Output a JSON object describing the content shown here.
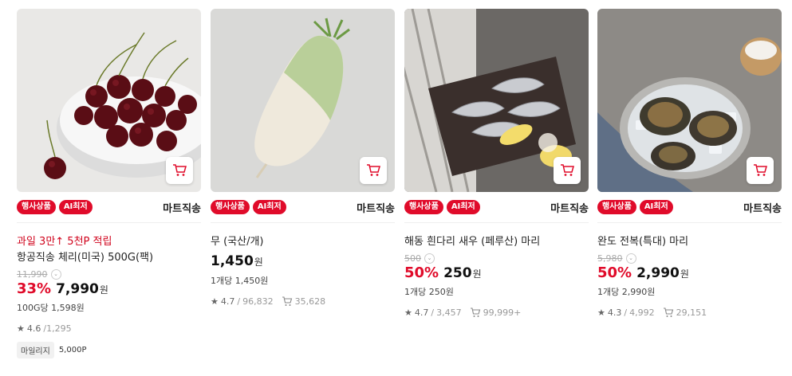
{
  "colors": {
    "accent": "#e00b2a",
    "promo": "#d0021b"
  },
  "products": [
    {
      "badges": [
        "행사상품",
        "AI최저"
      ],
      "seller": "마트직송",
      "promo": "과일 3만↑ 5천P 적립",
      "name": "항공직송 체리(미국) 500G(팩)",
      "original_price": "11,990",
      "discount_rate": "33%",
      "price": "7,990",
      "currency": "원",
      "unit_price": "100G당 1,598원",
      "rating": "4.6",
      "review_count": "1,295",
      "mileage_label": "마일리지",
      "mileage_value": "5,000P"
    },
    {
      "badges": [],
      "seller": "마트직송",
      "name": "무 (국산/개)",
      "price": "1,450",
      "currency": "원",
      "unit_price": "1개당 1,450원",
      "rating": "4.7",
      "review_count": "96,832",
      "wish_count": "35,628"
    },
    {
      "badges": [
        "행사상품",
        "AI최저"
      ],
      "seller": "마트직송",
      "name": "해동 흰다리 새우 (페루산) 마리",
      "original_price": "500",
      "discount_rate": "50%",
      "price": "250",
      "currency": "원",
      "unit_price": "1개당 250원",
      "rating": "4.7",
      "review_count": "3,457",
      "wish_count": "99,999+"
    },
    {
      "badges": [
        "행사상품",
        "AI최저"
      ],
      "seller": "마트직송",
      "name": "완도 전복(특대) 마리",
      "original_price": "5,980",
      "discount_rate": "50%",
      "price": "2,990",
      "currency": "원",
      "unit_price": "1개당 2,990원",
      "rating": "4.3",
      "review_count": "4,992",
      "wish_count": "29,151"
    }
  ],
  "icons": {
    "cart": "cart-icon",
    "star": "star-icon",
    "wish": "wish-cart-icon"
  }
}
